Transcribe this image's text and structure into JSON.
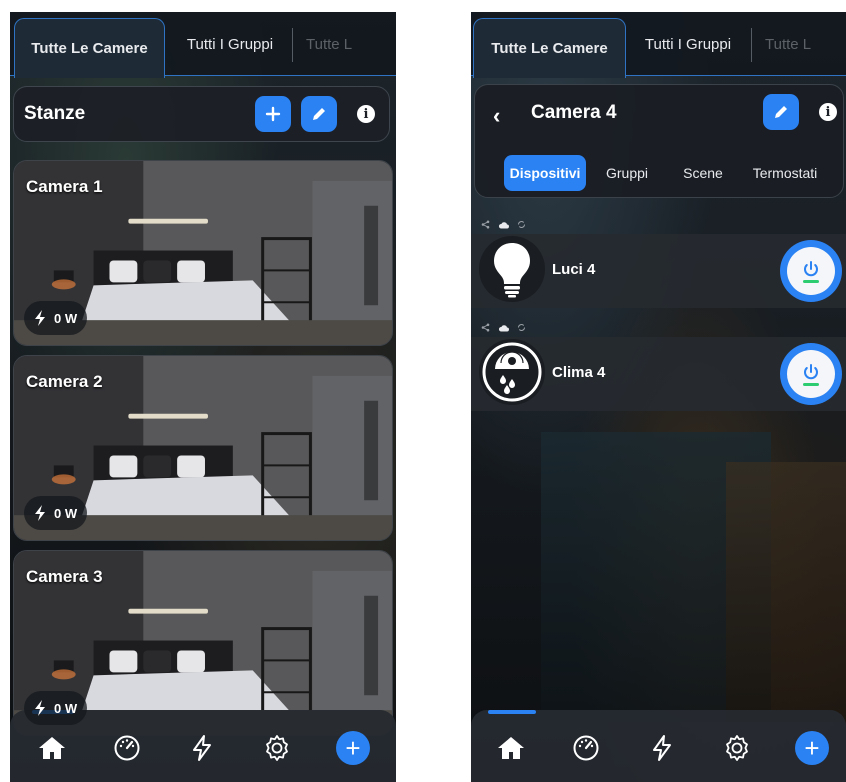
{
  "left": {
    "tabs": [
      {
        "label": "Tutte Le Camere",
        "active": true
      },
      {
        "label": "Tutti I Gruppi",
        "active": false
      },
      {
        "label": "Tutte L",
        "active": false
      }
    ],
    "section": {
      "title": "Stanze"
    },
    "rooms": [
      {
        "name": "Camera 1",
        "power": "0 W"
      },
      {
        "name": "Camera 2",
        "power": "0 W"
      },
      {
        "name": "Camera 3",
        "power": "0 W"
      }
    ]
  },
  "right": {
    "tabs": [
      {
        "label": "Tutte Le Camere",
        "active": true
      },
      {
        "label": "Tutti I Gruppi",
        "active": false
      },
      {
        "label": "Tutte L",
        "active": false
      }
    ],
    "room": {
      "title": "Camera 4"
    },
    "subtabs": [
      {
        "label": "Dispositivi",
        "active": true
      },
      {
        "label": "Gruppi",
        "active": false
      },
      {
        "label": "Scene",
        "active": false
      },
      {
        "label": "Termostati",
        "active": false
      }
    ],
    "devices": [
      {
        "name": "Luci 4",
        "icon": "bulb-icon",
        "power_state": "on"
      },
      {
        "name": "Clima 4",
        "icon": "climate-icon",
        "power_state": "on"
      }
    ]
  },
  "nav": {
    "items": [
      "home-icon",
      "dashboard-gauge-icon",
      "energy-bolt-icon",
      "settings-gear-icon",
      "add-icon"
    ]
  },
  "colors": {
    "accent": "#2a82f3",
    "tab_border": "#2f74c4",
    "power_led": "#2ecc71"
  }
}
